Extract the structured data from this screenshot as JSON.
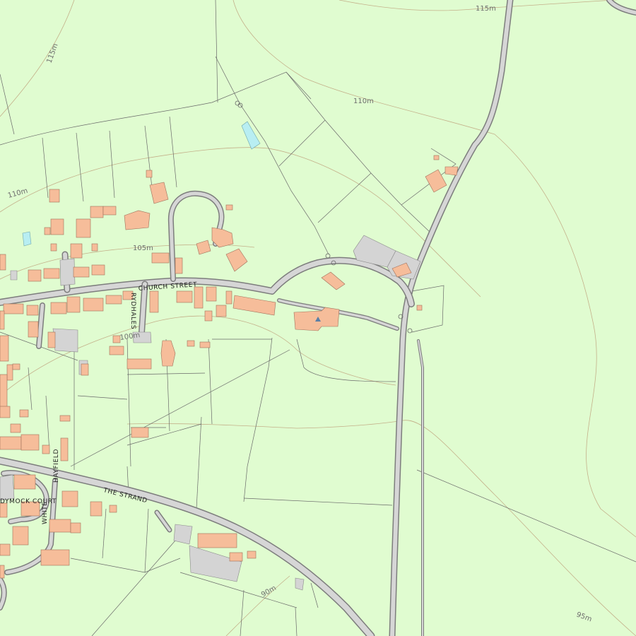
{
  "map": {
    "background_color": "#e0fcd0",
    "building_color": "#f6bd9a",
    "road_color": "#d6d6d6",
    "contour_color": "#c4b08a",
    "water_color": "#b8eef2"
  },
  "contour_labels": {
    "c115_top": "115m",
    "c115_left": "115m",
    "c110_top": "110m",
    "c110_left": "110m",
    "c105": "105m",
    "c100": "100m",
    "c90": "90m",
    "c95": "95m"
  },
  "street_labels": {
    "church_street": "CHURCH STREET",
    "rydhales": "RYDHALES",
    "the_strand": "THE STRAND",
    "dymock_court": "DYMOCK COURT",
    "hayfield": "HAYFIELD",
    "white": "WHITE"
  },
  "icons": {
    "church": "triangle-icon"
  }
}
